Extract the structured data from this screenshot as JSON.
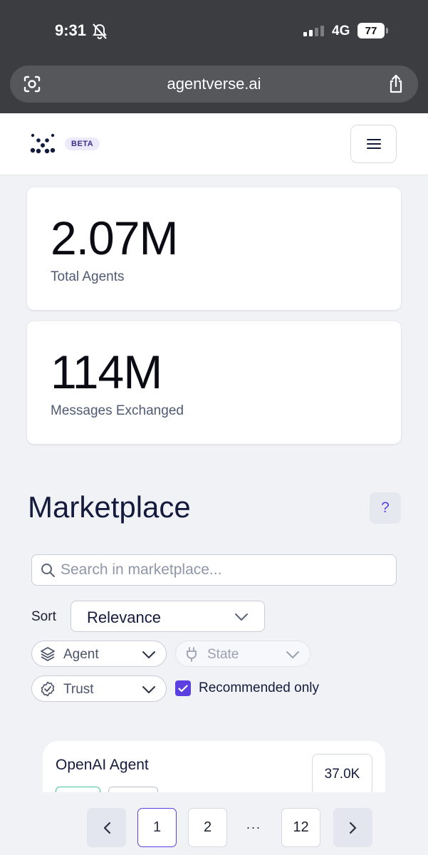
{
  "status_bar": {
    "time": "9:31",
    "network": "4G",
    "battery": "77"
  },
  "browser": {
    "url": "agentverse.ai"
  },
  "header": {
    "badge": "BETA"
  },
  "stats": [
    {
      "value": "2.07M",
      "label": "Total Agents"
    },
    {
      "value": "114M",
      "label": "Messages Exchanged"
    }
  ],
  "marketplace": {
    "title": "Marketplace",
    "help": "?",
    "search_placeholder": "Search in marketplace...",
    "sort_label": "Sort",
    "sort_value": "Relevance",
    "filters": {
      "agent": "Agent",
      "state": "State",
      "trust": "Trust"
    },
    "recommended_label": "Recommended only",
    "recommended_checked": true
  },
  "agent_card": {
    "name": "OpenAI Agent",
    "count": "37.0K"
  },
  "pagination": {
    "pages": [
      "1",
      "2",
      "12"
    ],
    "ellipsis": "···",
    "current": "1"
  },
  "colors": {
    "accent": "#5b3fe0",
    "title": "#141a3c",
    "background": "#f1f2f6",
    "tag_green": "#4bc39a"
  }
}
